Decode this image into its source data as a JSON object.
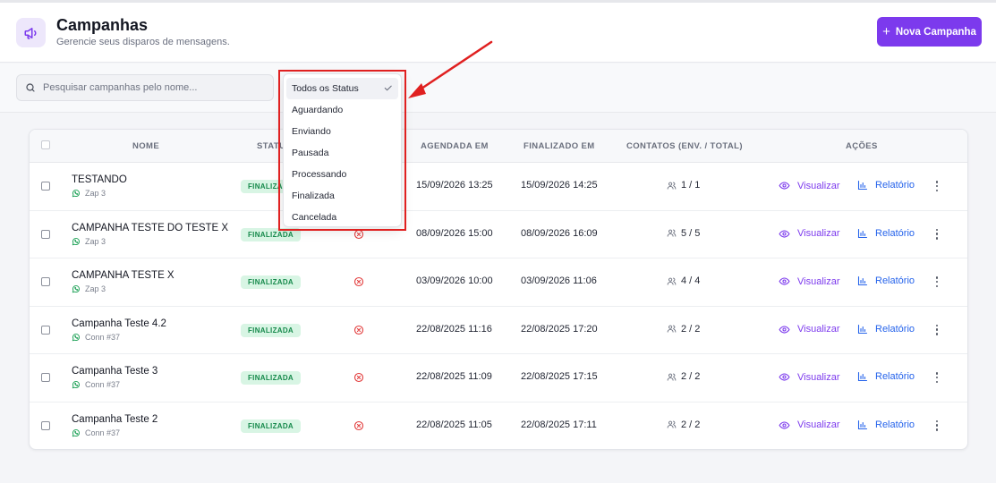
{
  "header": {
    "title": "Campanhas",
    "subtitle": "Gerencie seus disparos de mensagens.",
    "new_button_label": "Nova Campanha",
    "accent_color": "#7c3aed"
  },
  "filters": {
    "search_placeholder": "Pesquisar campanhas pelo nome...",
    "status_options": [
      "Todos os Status",
      "Aguardando",
      "Enviando",
      "Pausada",
      "Processando",
      "Finalizada",
      "Cancelada"
    ],
    "selected_status": "Todos os Status"
  },
  "table": {
    "headers": {
      "name": "NOME",
      "status": "STATUS",
      "scheduled": "AGENDADA EM",
      "finished": "FINALIZADO EM",
      "contacts": "CONTATOS (ENV. / TOTAL)",
      "actions": "AÇÕES"
    },
    "view_label": "Visualizar",
    "report_label": "Relatório",
    "rows": [
      {
        "name": "TESTANDO",
        "connection": "Zap 3",
        "status": "FINALIZADA",
        "scheduled": "15/09/2026 13:25",
        "finished": "15/09/2026 14:25",
        "contacts": "1 / 1"
      },
      {
        "name": "CAMPANHA TESTE DO TESTE X",
        "connection": "Zap 3",
        "status": "FINALIZADA",
        "scheduled": "08/09/2026 15:00",
        "finished": "08/09/2026 16:09",
        "contacts": "5 / 5"
      },
      {
        "name": "CAMPANHA TESTE X",
        "connection": "Zap 3",
        "status": "FINALIZADA",
        "scheduled": "03/09/2026 10:00",
        "finished": "03/09/2026 11:06",
        "contacts": "4 / 4"
      },
      {
        "name": "Campanha Teste 4.2",
        "connection": "Conn #37",
        "status": "FINALIZADA",
        "scheduled": "22/08/2025 11:16",
        "finished": "22/08/2025 17:20",
        "contacts": "2 / 2"
      },
      {
        "name": "Campanha Teste 3",
        "connection": "Conn #37",
        "status": "FINALIZADA",
        "scheduled": "22/08/2025 11:09",
        "finished": "22/08/2025 17:15",
        "contacts": "2 / 2"
      },
      {
        "name": "Campanha Teste 2",
        "connection": "Conn #37",
        "status": "FINALIZADA",
        "scheduled": "22/08/2025 11:05",
        "finished": "22/08/2025 17:11",
        "contacts": "2 / 2"
      }
    ]
  },
  "icons": {
    "header": "megaphone-icon",
    "search": "search-icon",
    "connection": "whatsapp-icon",
    "error": "x-circle-icon",
    "contacts": "users-icon",
    "view": "eye-icon",
    "report": "bar-chart-icon",
    "more": "more-vertical-icon",
    "selected": "check-icon"
  },
  "annotation_color": "#e02020"
}
